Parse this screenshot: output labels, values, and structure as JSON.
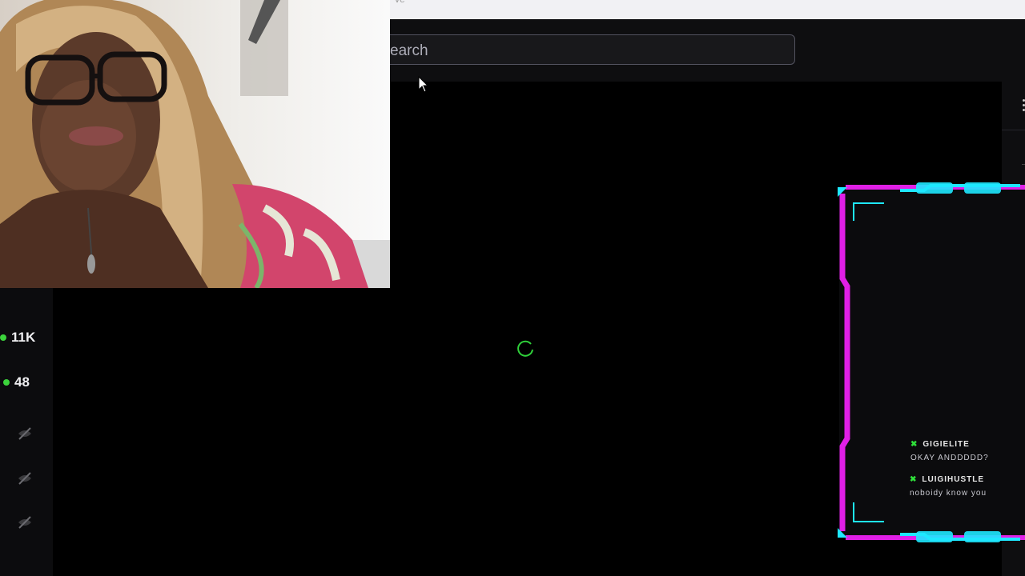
{
  "browser": {
    "top_fragment": "ve"
  },
  "search": {
    "placeholder_visible": "earch"
  },
  "stats": {
    "viewers": "11K",
    "followers_live": "48"
  },
  "chat": {
    "messages": [
      {
        "user": "GIGIELITE",
        "text": "OKAY ANDDDDD?"
      },
      {
        "user": "LUIGIHUSTLE",
        "text": "noboidy know you"
      }
    ]
  },
  "colors": {
    "live_green": "#3cd43c",
    "frame_magenta": "#e01fe6",
    "frame_cyan": "#1ee8ff",
    "spinner_green": "#2fcf3a"
  },
  "icons": {
    "hidden": "eye-slash-icon",
    "badge": "chat-badge-icon",
    "more": "more-vertical-icon"
  }
}
